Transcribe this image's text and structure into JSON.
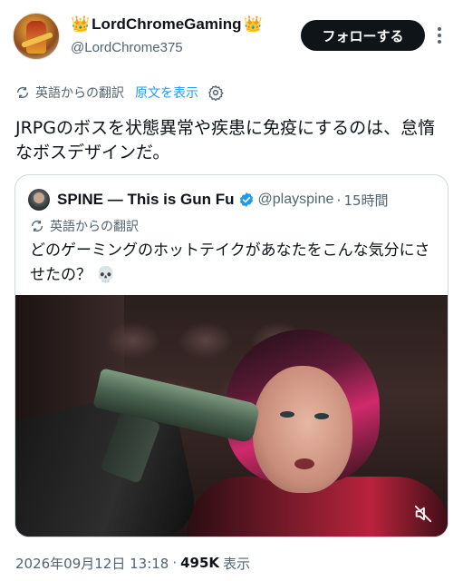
{
  "author": {
    "crown_left": "👑",
    "display_name": "LordChromeGaming",
    "crown_right": "👑",
    "handle": "@LordChrome375",
    "follow_label": "フォローする"
  },
  "translation": {
    "label": "英語からの翻訳",
    "show_original": "原文を表示"
  },
  "tweet": {
    "text": "JRPGのボスを状態異常や疾患に免疫にするのは、怠惰なボスデザインだ。"
  },
  "quote": {
    "name": "SPINE — This is Gun Fu",
    "handle": "@playspine",
    "dot": "·",
    "time": "15時間",
    "translation_label": "英語からの翻訳",
    "text": "どのゲーミングのホットテイクがあなたをこんな気分にさせたの？ 💀"
  },
  "footer": {
    "timestamp": "2026年09月12日 13:18",
    "dot": "·",
    "views": "495K",
    "views_label": "表示"
  },
  "colors": {
    "accent": "#1d9bf0",
    "text": "#0f1419",
    "muted": "#536471",
    "follow_bg": "#0f1419",
    "verified": "#1d9bf0"
  },
  "icons": [
    "translate-icon",
    "gear-icon",
    "verified-badge-icon",
    "more-icon",
    "mute-icon"
  ]
}
